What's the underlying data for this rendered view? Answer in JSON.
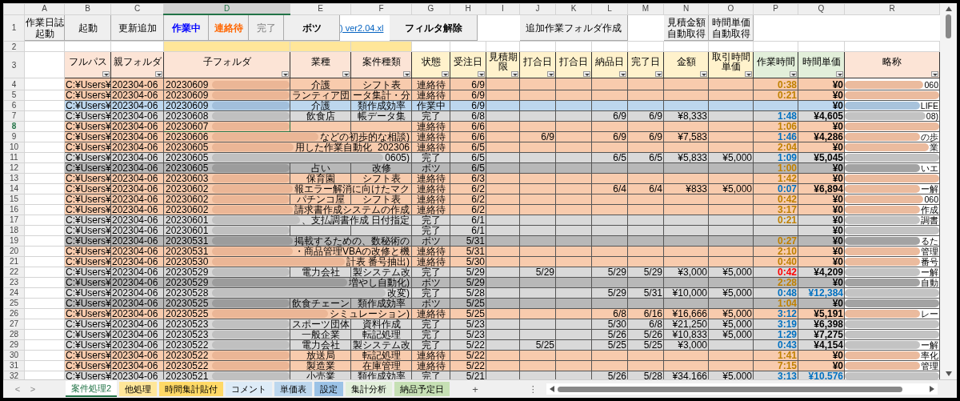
{
  "column_letters": [
    {
      "label": "A",
      "selected": false
    },
    {
      "label": "B",
      "selected": false
    },
    {
      "label": "C",
      "selected": false
    },
    {
      "label": "D",
      "selected": true
    },
    {
      "label": "E",
      "selected": false
    },
    {
      "label": "F",
      "selected": false
    },
    {
      "label": "G",
      "selected": false
    },
    {
      "label": "H",
      "selected": false
    },
    {
      "label": "I",
      "selected": false
    },
    {
      "label": "J",
      "selected": false
    },
    {
      "label": "K",
      "selected": false
    },
    {
      "label": "L",
      "selected": false
    },
    {
      "label": "M",
      "selected": false
    },
    {
      "label": "N",
      "selected": false
    },
    {
      "label": "O",
      "selected": false
    },
    {
      "label": "P",
      "selected": false
    },
    {
      "label": "Q",
      "selected": false
    },
    {
      "label": "R",
      "selected": false
    }
  ],
  "toolbar_row": {
    "number": "1",
    "buttons": [
      {
        "kind": "button",
        "lines": [
          "作業日誌",
          "起動"
        ],
        "bold": false
      },
      {
        "kind": "button",
        "lines": [
          "起動"
        ],
        "bold": false
      },
      {
        "kind": "button",
        "lines": [
          "更新追加"
        ],
        "bold": false
      },
      {
        "kind": "button",
        "lines": [
          "作業中"
        ],
        "color": "#0000ff",
        "bold": true
      },
      {
        "kind": "button",
        "lines": [
          "連絡待"
        ],
        "color": "#ff6600",
        "bold": true
      },
      {
        "kind": "button",
        "lines": [
          "完了"
        ],
        "color": "#7f7f7f",
        "bold": false
      },
      {
        "kind": "button",
        "lines": [
          "ボツ"
        ],
        "bold": true
      },
      {
        "kind": "link",
        "label": ") ver2.04.xl"
      },
      {
        "kind": "button",
        "lines": [
          "フィルタ解除"
        ],
        "bold": true
      },
      {
        "kind": "gap"
      },
      {
        "kind": "button",
        "lines": [
          "追加作業フォルダ作成"
        ],
        "bold": false
      },
      {
        "kind": "gap"
      },
      {
        "kind": "button",
        "lines": [
          "見積金額",
          "自動取得"
        ],
        "bold": false
      },
      {
        "kind": "button",
        "lines": [
          "時間単価",
          "自動取得"
        ],
        "bold": false
      }
    ]
  },
  "row_2": {
    "number": "2"
  },
  "header_row": {
    "number": "3",
    "columns": [
      {
        "lines": [
          "フルパス"
        ],
        "color": "#fce4d6"
      },
      {
        "lines": [
          "親フォルダ"
        ],
        "color": "#fce4d6"
      },
      {
        "lines": [
          "子フォルダ"
        ],
        "color": "#fce4d6"
      },
      {
        "lines": [
          "業種"
        ],
        "color": "#fce4d6"
      },
      {
        "lines": [
          "案件種類"
        ],
        "color": "#fce4d6"
      },
      {
        "lines": [
          "状態"
        ],
        "color": "#fff2cc"
      },
      {
        "lines": [
          "受注日"
        ],
        "color": "#fff2cc"
      },
      {
        "lines": [
          "見積期",
          "限"
        ],
        "color": "#fff2cc"
      },
      {
        "lines": [
          "打合日"
        ],
        "color": "#fff2cc"
      },
      {
        "lines": [
          "打合日"
        ],
        "color": "#fff2cc"
      },
      {
        "lines": [
          "納品日"
        ],
        "color": "#fff2cc"
      },
      {
        "lines": [
          "完了日"
        ],
        "color": "#fff2cc"
      },
      {
        "lines": [
          "金額"
        ],
        "color": "#fff2cc"
      },
      {
        "lines": [
          "取引時間",
          "単価"
        ],
        "color": "#fff2cc"
      },
      {
        "lines": [
          "作業時間"
        ],
        "color": "#e2efda"
      },
      {
        "lines": [
          "時間単価"
        ],
        "color": "#e2efda"
      },
      {
        "lines": [
          "略称"
        ],
        "color": "#fce4d6"
      }
    ]
  },
  "rows": [
    {
      "number": "4",
      "kind": "waiting",
      "selected": false,
      "path": "C:¥Users¥",
      "parent": "202304-06",
      "folder": "20230609",
      "industry": "介護",
      "case_type": "シフト表",
      "status": "連絡待",
      "order_date": "6/9",
      "work_time": {
        "text": "0:38",
        "color": "#c08000"
      },
      "time_rate": {
        "text": "¥0",
        "color": "#000000"
      },
      "abbrev_tail": "060"
    },
    {
      "number": "5",
      "kind": "waiting",
      "selected": false,
      "path": "C:¥Users¥",
      "parent": "202304-06",
      "folder": "20230609",
      "industry": "ランティア団",
      "case_type": "ータ集計・分",
      "status": "連絡待",
      "order_date": "6/9",
      "work_time": {
        "text": "0:21",
        "color": "#c08000"
      },
      "time_rate": {
        "text": "¥0",
        "color": "#000000"
      }
    },
    {
      "number": "6",
      "kind": "working",
      "selected": false,
      "path": "C:¥Users¥",
      "parent": "202304-06",
      "folder": "20230609",
      "industry": "介護",
      "case_type": "類作成効率",
      "status": "作業中",
      "order_date": "6/9",
      "time_rate": {
        "text": "¥0",
        "color": "#000000"
      },
      "abbrev_tail": "LIFE"
    },
    {
      "number": "7",
      "kind": "done",
      "selected": false,
      "path": "C:¥Users¥",
      "parent": "202304-06",
      "folder": "20230608",
      "industry": "飲食店",
      "case_type": "帳データ集",
      "status": "完了",
      "order_date": "6/8",
      "delivery": "6/9",
      "completed": "6/9",
      "amount": "¥8,333",
      "work_time": {
        "text": "1:48",
        "color": "#0070c0"
      },
      "time_rate": {
        "text": "¥4,605",
        "color": "#000000"
      },
      "abbrev_tail": "08)"
    },
    {
      "number": "8",
      "kind": "waiting",
      "selected": true,
      "path": "C:¥Users¥",
      "parent": "202304-06",
      "folder": "20230607",
      "status": "連絡待",
      "order_date": "6/6",
      "work_time": {
        "text": "1:06",
        "color": "#c08000"
      },
      "time_rate": {
        "text": "¥0",
        "color": "#000000"
      }
    },
    {
      "number": "9",
      "kind": "waiting",
      "selected": false,
      "path": "C:¥Users¥",
      "parent": "202304-06",
      "folder": "20230606",
      "note": "などの初歩的な相談)",
      "status": "連絡待",
      "order_date": "6/6",
      "meeting": "6/9",
      "delivery": "6/9",
      "completed": "6/9",
      "amount": "¥7,583",
      "work_time": {
        "text": "1:46",
        "color": "#0070c0"
      },
      "time_rate": {
        "text": "¥4,286",
        "color": "#000000"
      },
      "abbrev_tail": "の歩"
    },
    {
      "number": "10",
      "kind": "waiting",
      "selected": false,
      "path": "C:¥Users¥",
      "parent": "202304-06",
      "folder": "20230605",
      "note": "用した作業自動化_202306",
      "status": "連絡待",
      "order_date": "6/5",
      "work_time": {
        "text": "2:04",
        "color": "#c08000"
      },
      "time_rate": {
        "text": "¥0",
        "color": "#000000"
      },
      "abbrev_tail": "業"
    },
    {
      "number": "11",
      "kind": "done",
      "selected": false,
      "path": "C:¥Users¥",
      "parent": "202304-06",
      "folder": "20230605",
      "note": "0605)",
      "status": "完了",
      "order_date": "6/5",
      "delivery": "6/5",
      "completed": "6/5",
      "amount": "¥5,833",
      "hourly_rate": "¥5,000",
      "work_time": {
        "text": "1:09",
        "color": "#0070c0"
      },
      "time_rate": {
        "text": "¥5,045",
        "color": "#000000"
      }
    },
    {
      "number": "12",
      "kind": "dropped",
      "selected": false,
      "path": "C:¥Users¥",
      "parent": "202304-06",
      "folder": "20230605",
      "industry": "占い",
      "case_type": "改修",
      "status": "ボツ",
      "order_date": "6/5",
      "work_time": {
        "text": "1:00",
        "color": "#c08000"
      },
      "time_rate": {
        "text": "¥0",
        "color": "#000000"
      },
      "abbrev_tail": "いエ"
    },
    {
      "number": "13",
      "kind": "waiting",
      "selected": false,
      "path": "C:¥Users¥",
      "parent": "202304-06",
      "folder": "20230603",
      "industry": "保育園",
      "case_type": "シフト表",
      "status": "連絡待",
      "order_date": "6/3",
      "work_time": {
        "text": "1:42",
        "color": "#c08000"
      },
      "time_rate": {
        "text": "¥0",
        "color": "#000000"
      }
    },
    {
      "number": "14",
      "kind": "waiting",
      "selected": false,
      "path": "C:¥Users¥",
      "parent": "202304-06",
      "folder": "20230602",
      "note": "報エラー解消に向けたマク",
      "status": "連絡待",
      "order_date": "6/2",
      "delivery": "6/4",
      "completed": "6/4",
      "amount": "¥833",
      "hourly_rate": "¥5,000",
      "work_time": {
        "text": "0:07",
        "color": "#0070c0"
      },
      "time_rate": {
        "text": "¥6,894",
        "color": "#000000"
      },
      "abbrev_tail": "ー解"
    },
    {
      "number": "15",
      "kind": "waiting",
      "selected": false,
      "path": "C:¥Users¥",
      "parent": "202304-06",
      "folder": "20230602",
      "industry": "パチンコ屋",
      "case_type": "シフト表",
      "status": "連絡待",
      "order_date": "6/2",
      "work_time": {
        "text": "0:42",
        "color": "#c08000"
      },
      "time_rate": {
        "text": "¥0",
        "color": "#000000"
      },
      "abbrev_tail": "060"
    },
    {
      "number": "16",
      "kind": "waiting",
      "selected": false,
      "path": "C:¥Users¥",
      "parent": "202304-06",
      "folder": "20230602",
      "note": "請求書作成システムの作成",
      "status": "連絡待",
      "order_date": "6/2",
      "work_time": {
        "text": "3:17",
        "color": "#c08000"
      },
      "time_rate": {
        "text": "¥0",
        "color": "#000000"
      },
      "abbrev_tail": "作成"
    },
    {
      "number": "17",
      "kind": "done",
      "selected": false,
      "path": "C:¥Users¥",
      "parent": "202304-06",
      "folder": "20230601",
      "note": "、支払調書作成 日付指定",
      "status": "完了",
      "order_date": "6/1",
      "work_time": {
        "text": "0:21",
        "color": "#c08000"
      },
      "time_rate": {
        "text": "¥0",
        "color": "#000000"
      },
      "abbrev_tail": "調書"
    },
    {
      "number": "18",
      "kind": "done",
      "selected": false,
      "path": "C:¥Users¥",
      "parent": "202304-06",
      "folder": "20230601",
      "status": "完了",
      "order_date": "6/1",
      "time_rate": {
        "text": "¥0",
        "color": "#000000"
      }
    },
    {
      "number": "19",
      "kind": "dropped",
      "selected": false,
      "path": "C:¥Users¥",
      "parent": "202304-06",
      "folder": "20230531",
      "note": "掲載するための、数秘術の",
      "status": "ボツ",
      "order_date": "5/31",
      "work_time": {
        "text": "0:27",
        "color": "#c08000"
      },
      "time_rate": {
        "text": "¥0",
        "color": "#000000"
      },
      "abbrev_tail": "るた"
    },
    {
      "number": "20",
      "kind": "waiting",
      "selected": false,
      "path": "C:¥Users¥",
      "parent": "202304-06",
      "folder": "20230531",
      "note": "・商品管理VBAの改修と機",
      "status": "連絡待",
      "order_date": "5/31",
      "work_time": {
        "text": "2:10",
        "color": "#c08000"
      },
      "time_rate": {
        "text": "¥0",
        "color": "#000000"
      },
      "abbrev_tail": "管理"
    },
    {
      "number": "21",
      "kind": "waiting",
      "selected": false,
      "path": "C:¥Users¥",
      "parent": "202304-06",
      "folder": "20230530",
      "note": "計表 番号抽出)",
      "status": "連絡待",
      "order_date": "5/30",
      "work_time": {
        "text": "0:40",
        "color": "#c08000"
      },
      "time_rate": {
        "text": "¥0",
        "color": "#000000"
      },
      "abbrev_tail": "番号"
    },
    {
      "number": "22",
      "kind": "done",
      "selected": false,
      "path": "C:¥Users¥",
      "parent": "202304-06",
      "folder": "20230529",
      "industry": "電力会社",
      "case_type": "製システム改",
      "status": "完了",
      "order_date": "5/29",
      "meeting": "5/29",
      "delivery": "5/29",
      "completed": "5/29",
      "amount": "¥3,000",
      "hourly_rate": "¥5,000",
      "work_time": {
        "text": "0:42",
        "color": "#ff0000"
      },
      "time_rate": {
        "text": "¥4,209",
        "color": "#000000"
      },
      "abbrev_tail": "ー解"
    },
    {
      "number": "23",
      "kind": "dropped",
      "selected": false,
      "path": "C:¥Users¥",
      "parent": "202304-06",
      "folder": "20230529",
      "note": "増やし自動化)",
      "status": "ボツ",
      "order_date": "5/29",
      "work_time": {
        "text": "2:28",
        "color": "#c08000"
      },
      "time_rate": {
        "text": "¥0",
        "color": "#000000"
      },
      "abbrev_tail": "自動"
    },
    {
      "number": "24",
      "kind": "done",
      "selected": false,
      "path": "C:¥Users¥",
      "parent": "202304-06",
      "folder": "20230528",
      "note": "改変)",
      "status": "完了",
      "order_date": "5/28",
      "delivery": "5/29",
      "completed": "5/31",
      "amount": "¥10,000",
      "hourly_rate": "¥5,000",
      "work_time": {
        "text": "0:48",
        "color": "#0070c0"
      },
      "time_rate": {
        "text": "¥12,384",
        "color": "#0070c0"
      }
    },
    {
      "number": "25",
      "kind": "dropped",
      "selected": false,
      "path": "C:¥Users¥",
      "parent": "202304-06",
      "folder": "20230525",
      "industry": "飲食チェーン",
      "case_type": "類作成効率",
      "status": "ボツ",
      "order_date": "5/25",
      "work_time": {
        "text": "1:04",
        "color": "#c08000"
      },
      "time_rate": {
        "text": "¥0",
        "color": "#000000"
      }
    },
    {
      "number": "26",
      "kind": "waiting",
      "selected": false,
      "path": "C:¥Users¥",
      "parent": "202304-06",
      "folder": "20230525",
      "note": "シミュレーション)",
      "status": "連絡待",
      "order_date": "5/25",
      "delivery": "6/8",
      "completed": "6/16",
      "amount": "¥16,666",
      "hourly_rate": "¥5,000",
      "work_time": {
        "text": "3:12",
        "color": "#0070c0"
      },
      "time_rate": {
        "text": "¥5,191",
        "color": "#000000"
      },
      "abbrev_tail": "レー"
    },
    {
      "number": "27",
      "kind": "done",
      "selected": false,
      "path": "C:¥Users¥",
      "parent": "202304-06",
      "folder": "20230523",
      "industry": "スポーツ団体",
      "case_type": "資料作成",
      "status": "完了",
      "order_date": "5/23",
      "delivery": "5/30",
      "completed": "6/8",
      "amount": "¥21,250",
      "hourly_rate": "¥5,000",
      "work_time": {
        "text": "3:19",
        "color": "#0070c0"
      },
      "time_rate": {
        "text": "¥6,398",
        "color": "#000000"
      }
    },
    {
      "number": "28",
      "kind": "done",
      "selected": false,
      "path": "C:¥Users¥",
      "parent": "202304-06",
      "folder": "20230523",
      "industry": "一般企業",
      "case_type": "転記処理",
      "status": "完了",
      "order_date": "5/23",
      "delivery": "5/26",
      "completed": "5/26",
      "amount": "¥10,833",
      "hourly_rate": "¥5,000",
      "work_time": {
        "text": "1:29",
        "color": "#0070c0"
      },
      "time_rate": {
        "text": "¥7,275",
        "color": "#000000"
      }
    },
    {
      "number": "29",
      "kind": "done",
      "selected": false,
      "path": "C:¥Users¥",
      "parent": "202304-06",
      "folder": "20230522",
      "industry": "電力会社",
      "case_type": "製システム改",
      "status": "完了",
      "order_date": "5/22",
      "meeting": "5/25",
      "delivery": "5/25",
      "completed": "5/25",
      "amount": "¥3,000",
      "work_time": {
        "text": "0:43",
        "color": "#0070c0"
      },
      "time_rate": {
        "text": "¥4,154",
        "color": "#000000"
      },
      "abbrev_tail": "ー解"
    },
    {
      "number": "30",
      "kind": "waiting",
      "selected": false,
      "path": "C:¥Users¥",
      "parent": "202304-06",
      "folder": "20230522",
      "industry": "放送局",
      "case_type": "転記処理",
      "status": "連絡待",
      "order_date": "5/22",
      "work_time": {
        "text": "1:41",
        "color": "#c08000"
      },
      "time_rate": {
        "text": "¥0",
        "color": "#000000"
      },
      "abbrev_tail": "率化"
    },
    {
      "number": "31",
      "kind": "waiting",
      "selected": false,
      "path": "C:¥Users¥",
      "parent": "202304-06",
      "folder": "20230522",
      "industry": "製造業",
      "case_type": "在庫管理",
      "status": "連絡待",
      "order_date": "5/22",
      "work_time": {
        "text": "7:15",
        "color": "#c08000"
      },
      "time_rate": {
        "text": "¥0",
        "color": "#000000"
      },
      "abbrev_tail": "管理"
    },
    {
      "number": "32",
      "kind": "done",
      "selected": false,
      "path": "C:¥Users¥",
      "parent": "202304-06",
      "folder": "20230521",
      "industry": "小売業",
      "case_type": "類作成効率",
      "status": "完了",
      "order_date": "5/21",
      "delivery": "5/26",
      "completed": "5/28",
      "amount": "¥34,166",
      "hourly_rate": "¥5,000",
      "work_time": {
        "text": "3:13",
        "color": "#0070c0"
      },
      "time_rate": {
        "text": "¥10,576",
        "color": "#0070c0"
      }
    }
  ],
  "sheet_tabs": [
    {
      "label": "案件処理2",
      "color": "#ffffff",
      "selected": true
    },
    {
      "label": "他処理",
      "color": "#ffe699",
      "selected": false
    },
    {
      "label": "時間集計貼付",
      "color": "#ffd966",
      "selected": false
    },
    {
      "label": "コメント",
      "color": "#ddebf7",
      "selected": false
    },
    {
      "label": "単価表",
      "color": "#bdd7ee",
      "selected": false
    },
    {
      "label": "設定",
      "color": "#9bc2e6",
      "selected": false
    },
    {
      "label": "集計分析",
      "color": "#e2efda",
      "selected": false
    },
    {
      "label": "納品予定日",
      "color": "#c6e0b4",
      "selected": false
    }
  ],
  "tab_nav": {
    "prev": "<",
    "next": ">",
    "add": "+",
    "more": "⋮"
  }
}
